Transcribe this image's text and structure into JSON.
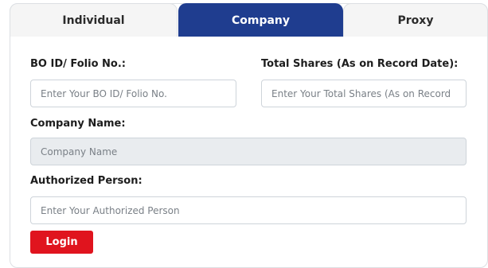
{
  "tabs": [
    {
      "label": "Individual"
    },
    {
      "label": "Company"
    },
    {
      "label": "Proxy"
    }
  ],
  "form": {
    "bo_id": {
      "label": "BO ID/ Folio No.:",
      "placeholder": "Enter Your BO ID/ Folio No."
    },
    "total_shares": {
      "label": "Total Shares (As on Record Date):",
      "placeholder": "Enter Your Total Shares (As on Record"
    },
    "company_name": {
      "label": "Company Name:",
      "placeholder": "Company Name"
    },
    "authorized_person": {
      "label": "Authorized Person:",
      "placeholder": "Enter Your Authorized Person"
    },
    "login_label": "Login"
  },
  "colors": {
    "active_tab": "#1f3d8f",
    "login_button": "#e0141e"
  }
}
